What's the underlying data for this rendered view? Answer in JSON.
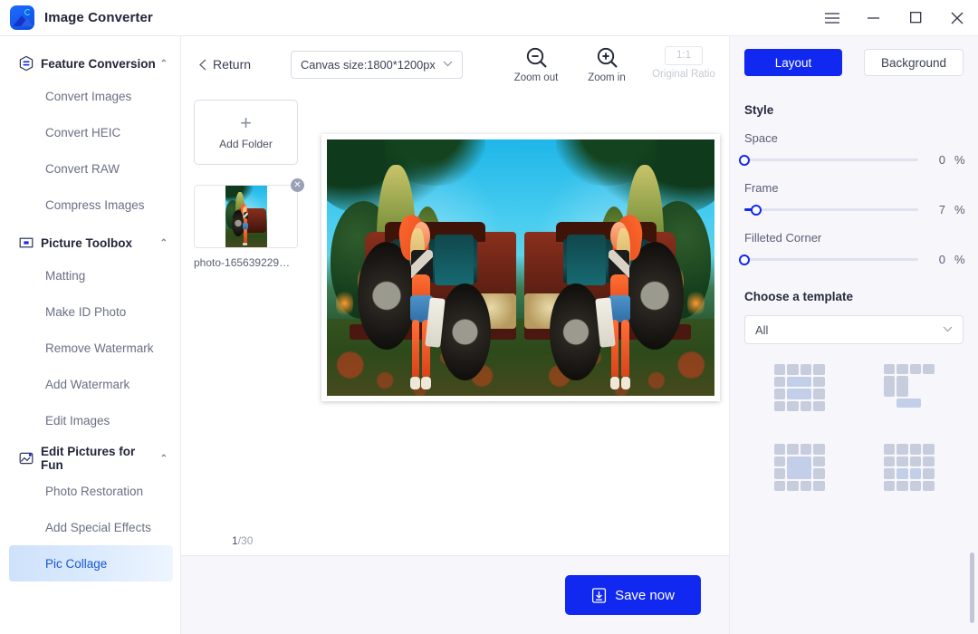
{
  "window": {
    "app_title": "Image Converter",
    "logo_icon": "image-converter-logo",
    "menu_icon": "hamburger-menu-icon",
    "minimize_icon": "minimize-icon",
    "maximize_icon": "maximize-icon",
    "close_icon": "close-icon"
  },
  "sidebar": {
    "sections": [
      {
        "title": "Feature Conversion",
        "icon": "conversion-icon",
        "caret": "⌃",
        "items": [
          "Convert Images",
          "Convert HEIC",
          "Convert RAW",
          "Compress Images"
        ]
      },
      {
        "title": "Picture Toolbox",
        "icon": "toolbox-icon",
        "caret": "⌃",
        "items": [
          "Matting",
          "Make ID Photo",
          "Remove Watermark",
          "Add Watermark",
          "Edit Images"
        ]
      },
      {
        "title": "Edit Pictures for Fun",
        "icon": "fun-edit-icon",
        "caret": "⌃",
        "items": [
          "Photo Restoration",
          "Add Special Effects",
          "Pic Collage"
        ]
      }
    ],
    "active_item": "Pic Collage"
  },
  "toolbar": {
    "return_label": "Return",
    "return_icon": "chevron-left-icon",
    "canvas_size_value": "Canvas size:1800*1200px",
    "canvas_size_chevron": "⌄",
    "zoom_out_label": "Zoom out",
    "zoom_out_icon": "zoom-out-icon",
    "zoom_in_label": "Zoom in",
    "zoom_in_icon": "zoom-in-icon",
    "original_ratio_label": "Original Ratio",
    "original_ratio_value": "1:1"
  },
  "thumbnails": {
    "add_folder_label": "Add Folder",
    "add_folder_icon": "plus-icon",
    "files": [
      {
        "name": "photo-165639229…",
        "remove_icon": "remove-icon"
      }
    ]
  },
  "canvas": {
    "page_counter_current": "1",
    "page_counter_total": "/30",
    "collage_layout": "two-panel-mirrored"
  },
  "footer": {
    "save_label": "Save now",
    "save_icon": "download-icon"
  },
  "right_panel": {
    "tabs": [
      {
        "label": "Layout",
        "active": true
      },
      {
        "label": "Background",
        "active": false
      }
    ],
    "style_title": "Style",
    "sliders": [
      {
        "label": "Space",
        "value": "0",
        "unit": "%",
        "percent": 0
      },
      {
        "label": "Frame",
        "value": "7",
        "unit": "%",
        "percent": 7
      },
      {
        "label": "Filleted Corner",
        "value": "0",
        "unit": "%",
        "percent": 0
      }
    ],
    "template_title": "Choose a template",
    "template_filter_value": "All",
    "template_filter_chevron": "⌄",
    "templates": [
      {
        "name": "template-1"
      },
      {
        "name": "template-2"
      },
      {
        "name": "template-3"
      },
      {
        "name": "template-4"
      }
    ],
    "scrollbar": "panel-scrollbar"
  },
  "colors": {
    "accent": "#1028f0",
    "active_nav_text": "#1756d8",
    "panel_bg": "#f7f6fb",
    "text": "#3a3f55",
    "muted": "#9aa0b0"
  }
}
